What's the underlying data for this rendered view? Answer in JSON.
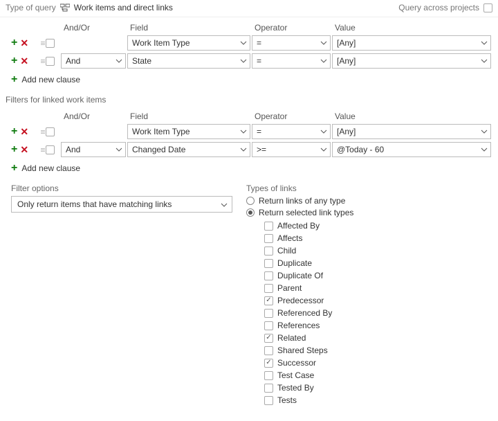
{
  "top": {
    "type_of_query_label": "Type of query",
    "type_of_query_value": "Work items and direct links",
    "query_across_label": "Query across projects",
    "query_across_checked": false
  },
  "headers": {
    "andor": "And/Or",
    "field": "Field",
    "operator": "Operator",
    "value": "Value"
  },
  "top_clauses": [
    {
      "andor": "",
      "andor_visible": false,
      "field": "Work Item Type",
      "operator": "=",
      "value": "[Any]"
    },
    {
      "andor": "And",
      "andor_visible": true,
      "field": "State",
      "operator": "=",
      "value": "[Any]"
    }
  ],
  "add_new_clause": "Add new clause",
  "linked_filters_title": "Filters for linked work items",
  "linked_clauses": [
    {
      "andor": "",
      "andor_visible": false,
      "field": "Work Item Type",
      "operator": "=",
      "value": "[Any]"
    },
    {
      "andor": "And",
      "andor_visible": true,
      "field": "Changed Date",
      "operator": ">=",
      "value": "@Today - 60"
    }
  ],
  "filter_options": {
    "label": "Filter options",
    "value": "Only return items that have matching links"
  },
  "link_types_section": {
    "label": "Types of links",
    "radio_any": "Return links of any type",
    "radio_selected": "Return selected link types",
    "selected_radio": "selected",
    "types": [
      {
        "name": "Affected By",
        "checked": false
      },
      {
        "name": "Affects",
        "checked": false
      },
      {
        "name": "Child",
        "checked": false
      },
      {
        "name": "Duplicate",
        "checked": false
      },
      {
        "name": "Duplicate Of",
        "checked": false
      },
      {
        "name": "Parent",
        "checked": false
      },
      {
        "name": "Predecessor",
        "checked": true
      },
      {
        "name": "Referenced By",
        "checked": false
      },
      {
        "name": "References",
        "checked": false
      },
      {
        "name": "Related",
        "checked": true
      },
      {
        "name": "Shared Steps",
        "checked": false
      },
      {
        "name": "Successor",
        "checked": true
      },
      {
        "name": "Test Case",
        "checked": false
      },
      {
        "name": "Tested By",
        "checked": false
      },
      {
        "name": "Tests",
        "checked": false
      }
    ]
  }
}
